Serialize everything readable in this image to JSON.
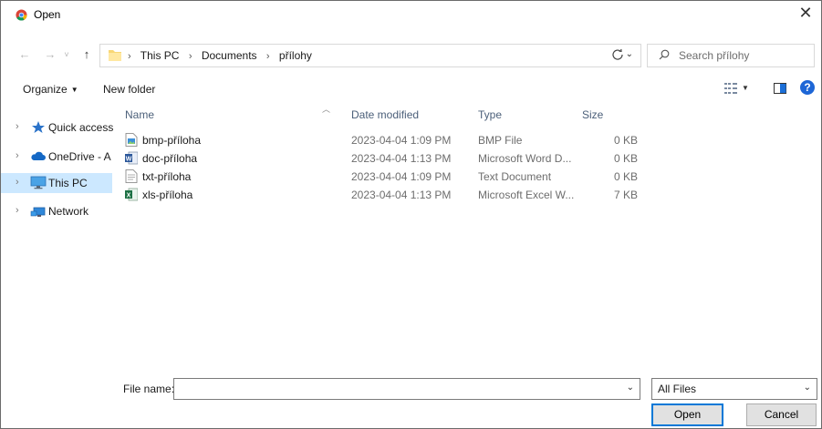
{
  "window": {
    "title": "Open",
    "close_glyph": "✕",
    "app_icon": "chrome-icon"
  },
  "address": {
    "crumbs": [
      "This PC",
      "Documents",
      "přílohy"
    ],
    "search_placeholder": "Search přílohy"
  },
  "toolbar": {
    "organize_label": "Organize",
    "new_folder_label": "New folder"
  },
  "nav_pane": {
    "items": [
      {
        "label": "Quick access",
        "icon": "star-icon"
      },
      {
        "label": "OneDrive - A",
        "icon": "cloud-icon"
      },
      {
        "label": "This PC",
        "icon": "monitor-icon",
        "selected": true
      },
      {
        "label": "Network",
        "icon": "network-icon"
      }
    ]
  },
  "columns": {
    "name": "Name",
    "date": "Date modified",
    "type": "Type",
    "size": "Size"
  },
  "files": [
    {
      "name": "bmp-příloha",
      "date": "2023-04-04 1:09 PM",
      "type": "BMP File",
      "size": "0 KB",
      "icon": "image-file-icon"
    },
    {
      "name": "doc-příloha",
      "date": "2023-04-04 1:13 PM",
      "type": "Microsoft Word D...",
      "size": "0 KB",
      "icon": "word-file-icon"
    },
    {
      "name": "txt-příloha",
      "date": "2023-04-04 1:09 PM",
      "type": "Text Document",
      "size": "0 KB",
      "icon": "text-file-icon"
    },
    {
      "name": "xls-příloha",
      "date": "2023-04-04 1:13 PM",
      "type": "Microsoft Excel W...",
      "size": "7 KB",
      "icon": "excel-file-icon"
    }
  ],
  "footer": {
    "file_name_label": "File name:",
    "file_name_value": "",
    "filter_value": "All Files",
    "open_label": "Open",
    "cancel_label": "Cancel"
  },
  "colors": {
    "selection": "#cce8ff",
    "accent": "#0078d7",
    "header_text": "#4c607a"
  }
}
